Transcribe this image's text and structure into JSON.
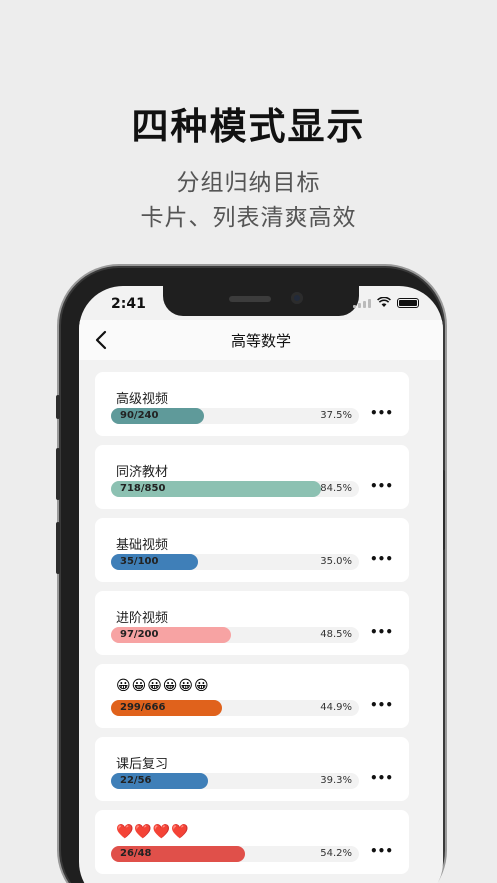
{
  "hero": {
    "title": "四种模式显示",
    "subtitle_line1": "分组归纳目标",
    "subtitle_line2": "卡片、列表清爽高效"
  },
  "status_bar": {
    "time": "2:41"
  },
  "nav": {
    "back_icon": "chevron-left-icon",
    "back_glyph": "‹",
    "title": "高等数学"
  },
  "more_glyph": "•••",
  "cards": [
    {
      "title": "高级视频",
      "progress": "90/240",
      "percent": "37.5%",
      "fraction": 0.375,
      "color": "#5f9a9a"
    },
    {
      "title": "同济教材",
      "progress": "718/850",
      "percent": "84.5%",
      "fraction": 0.845,
      "color": "#8cc1b2"
    },
    {
      "title": "基础视频",
      "progress": "35/100",
      "percent": "35.0%",
      "fraction": 0.35,
      "color": "#3f7fb8"
    },
    {
      "title": "进阶视频",
      "progress": "97/200",
      "percent": "48.5%",
      "fraction": 0.485,
      "color": "#f7a3a3"
    },
    {
      "title": "😀😀😀😀😀😀",
      "progress": "299/666",
      "percent": "44.9%",
      "fraction": 0.449,
      "color": "#e0621c",
      "emoji": true
    },
    {
      "title": "课后复习",
      "progress": "22/56",
      "percent": "39.3%",
      "fraction": 0.393,
      "color": "#3f7fb8"
    },
    {
      "title": "❤️❤️❤️❤️",
      "progress": "26/48",
      "percent": "54.2%",
      "fraction": 0.542,
      "color": "#e0504a",
      "emoji": true
    }
  ]
}
